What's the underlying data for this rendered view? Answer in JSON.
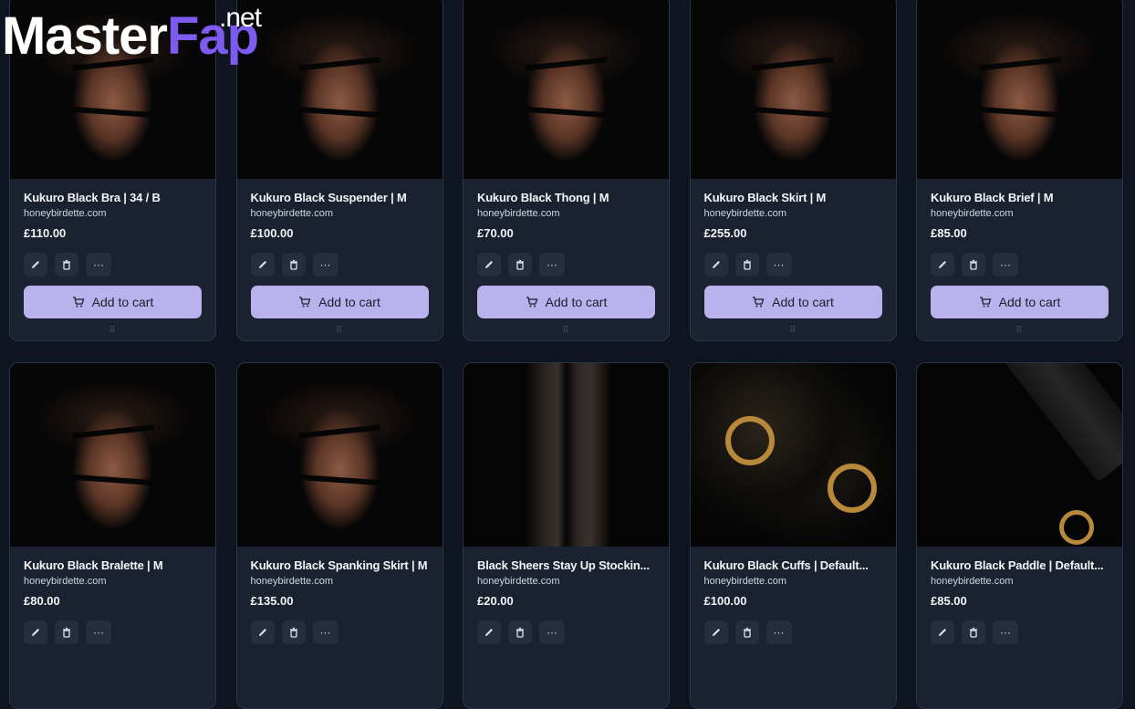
{
  "brand": {
    "main": "Master",
    "accent": "Fap",
    "suffix": ".net"
  },
  "actions": {
    "edit_icon": "pencil-icon",
    "delete_icon": "trash-icon",
    "more_icon": "more-icon",
    "more_label": "···",
    "add_to_cart_label": "Add to cart",
    "drag_label": "⠿"
  },
  "products": [
    {
      "title": "Kukuro Black Bra | 34 / B",
      "domain": "honeybirdette.com",
      "price": "£110.00"
    },
    {
      "title": "Kukuro Black Suspender | M",
      "domain": "honeybirdette.com",
      "price": "£100.00"
    },
    {
      "title": "Kukuro Black Thong | M",
      "domain": "honeybirdette.com",
      "price": "£70.00"
    },
    {
      "title": "Kukuro Black Skirt | M",
      "domain": "honeybirdette.com",
      "price": "£255.00"
    },
    {
      "title": "Kukuro Black Brief | M",
      "domain": "honeybirdette.com",
      "price": "£85.00"
    },
    {
      "title": "Kukuro Black Bralette | M",
      "domain": "honeybirdette.com",
      "price": "£80.00"
    },
    {
      "title": "Kukuro Black Spanking Skirt | M",
      "domain": "honeybirdette.com",
      "price": "£135.00"
    },
    {
      "title": "Black Sheers Stay Up Stockin...",
      "domain": "honeybirdette.com",
      "price": "£20.00"
    },
    {
      "title": "Kukuro Black Cuffs | Default...",
      "domain": "honeybirdette.com",
      "price": "£100.00"
    },
    {
      "title": "Kukuro Black Paddle | Default...",
      "domain": "honeybirdette.com",
      "price": "£85.00"
    }
  ],
  "colors": {
    "background": "#0f1520",
    "card": "#1a2230",
    "button": "#b9b2ec",
    "accent_logo": "#7d5bf0"
  }
}
